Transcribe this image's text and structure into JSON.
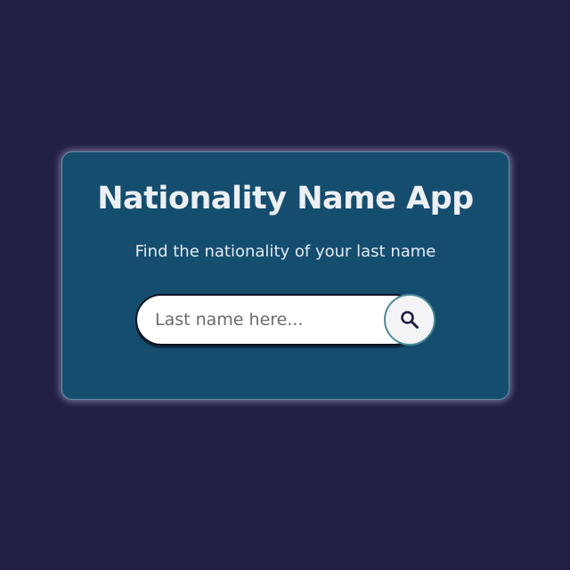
{
  "app": {
    "title": "Nationality Name App",
    "subtitle": "Find the nationality of your last name"
  },
  "search": {
    "placeholder": "Last name here...",
    "value": "",
    "button_icon": "search-icon"
  },
  "colors": {
    "background": "#221f46",
    "card": "#154d6f",
    "text": "#ecf0f4",
    "icon": "#1f1b45"
  }
}
